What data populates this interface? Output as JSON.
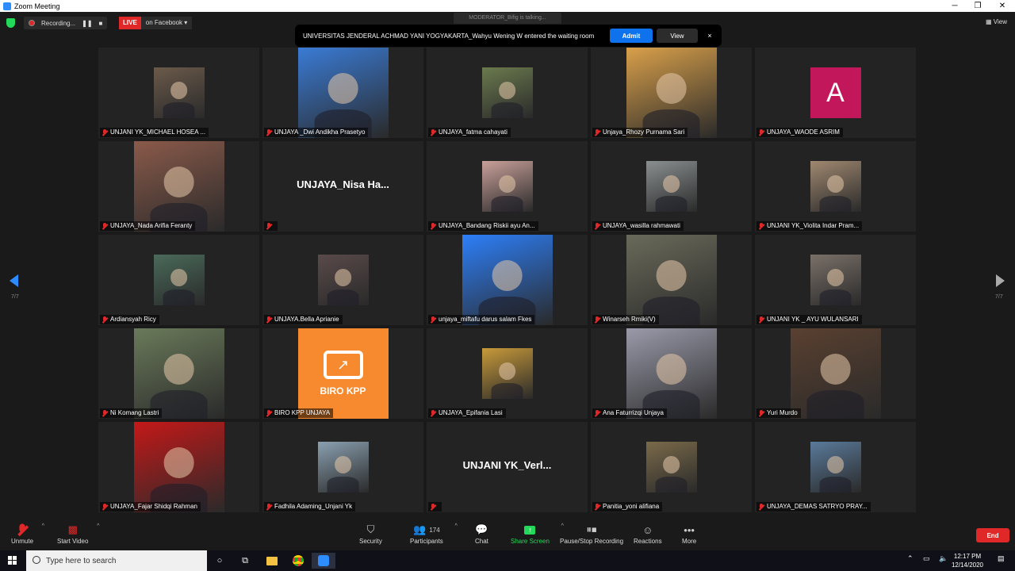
{
  "window": {
    "title": "Zoom Meeting"
  },
  "topbar": {
    "recording_label": "Recording...",
    "live_label": "LIVE",
    "live_platform": "on Facebook",
    "view_label": "View",
    "moderator_text": "MODERATOR_Bifig is talking..."
  },
  "notification": {
    "message": "UNIVERSITAS JENDERAL ACHMAD YANI YOGYAKARTA_Wahyu Wening W entered the waiting room",
    "admit_label": "Admit",
    "view_label": "View",
    "close_symbol": "×"
  },
  "navigation": {
    "page_left": "7/7",
    "page_right": "7/7"
  },
  "participants": [
    {
      "name": "UNJANI YK_MICHAEL HOSEA ...",
      "photo_color": "#6b5a4a",
      "big": false
    },
    {
      "name": "UNJAYA _Dwi Andikha Prasetyo",
      "photo_color": "#3a7bd5",
      "big": true
    },
    {
      "name": "UNJAYA_fatma cahayati",
      "photo_color": "#6b7a4e",
      "big": false
    },
    {
      "name": "Unjaya_Rhozy Purnama Sari",
      "photo_color": "#d9a04a",
      "big": true
    },
    {
      "name": "UNJAYA_WAODE ASRIM",
      "avatar_letter": "A",
      "avatar_color": "#c2185b",
      "big": false
    },
    {
      "name": "UNJAYA_Nada Arifia Feranty",
      "photo_color": "#8a5a4a",
      "big": true
    },
    {
      "name": "",
      "display_name": "UNJAYA_Nisa  Ha...",
      "no_video": true
    },
    {
      "name": "UNJAYA_Bandang Riskii ayu An...",
      "photo_color": "#c9a09a",
      "big": false
    },
    {
      "name": "UNJAYA_wasilla rahmawati",
      "photo_color": "#8a8f90",
      "big": false
    },
    {
      "name": "UNJANI YK_Violita Indar Pram...",
      "photo_color": "#a08870",
      "big": false
    },
    {
      "name": "Ardiansyah Ricy",
      "photo_color": "#4a6a5a",
      "big": false
    },
    {
      "name": "UNJAYA.Bella Aprianie",
      "photo_color": "#5a4a4a",
      "big": false
    },
    {
      "name": "unjaya_miftafu darus salam Fkes",
      "photo_color": "#2d7ff9",
      "big": true
    },
    {
      "name": "Winarseh Rmiki(V)",
      "photo_color": "#6a6a5a",
      "big": true
    },
    {
      "name": "UNJANI YK _ AYU WULANSARI",
      "photo_color": "#7a7068",
      "big": false
    },
    {
      "name": "Ni Komang Lastri",
      "photo_color": "#6a7a5a",
      "big": true
    },
    {
      "name": "BIRO KPP UNJAYA",
      "photo_color": "#f7892e",
      "logo_text": "BIRO KPP",
      "big": true
    },
    {
      "name": "UNJAYA_Epifania Lasi",
      "photo_color": "#c89a3a",
      "big": false
    },
    {
      "name": "Ana Faturrizqi Unjaya",
      "photo_color": "#9a9aaa",
      "big": true
    },
    {
      "name": "Yuri Murdo",
      "photo_color": "#5a4030",
      "big": true
    },
    {
      "name": "UNJAYA_Fajar Shidqi Rahman",
      "photo_color": "#c41818",
      "big": true
    },
    {
      "name": "Fadhila Adaming_Unjani Yk",
      "photo_color": "#8aa0b0",
      "big": false
    },
    {
      "name": "",
      "display_name": "UNJANI  YK_Verl...",
      "no_video": true
    },
    {
      "name": "Panitia_yoni alifiana",
      "photo_color": "#7a6a4a",
      "big": false
    },
    {
      "name": "UNJAYA_DEMAS SATRYO PRAY...",
      "photo_color": "#5a7a9a",
      "big": false
    }
  ],
  "toolbar": {
    "unmute": "Unmute",
    "start_video": "Start Video",
    "security": "Security",
    "participants": "Participants",
    "participants_count": "174",
    "chat": "Chat",
    "share_screen": "Share Screen",
    "pause_recording": "Pause/Stop Recording",
    "reactions": "Reactions",
    "more": "More",
    "end": "End",
    "share_color": "#23d959"
  },
  "taskbar": {
    "search_placeholder": "Type here to search",
    "time": "12:17 PM",
    "date": "12/14/2020"
  }
}
